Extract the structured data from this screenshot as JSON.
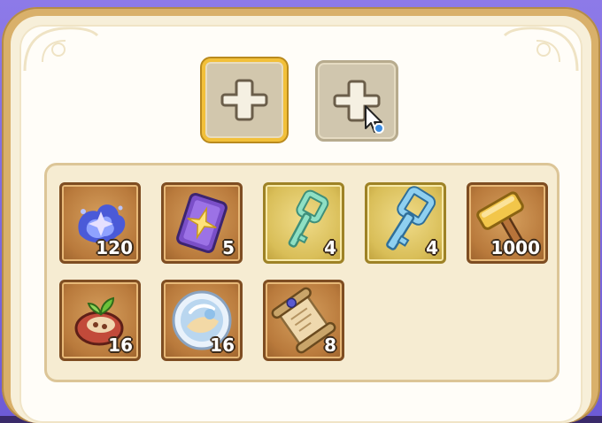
{
  "equip_slots": [
    {
      "name": "slot-1",
      "icon": "plus-icon",
      "selected": true
    },
    {
      "name": "slot-2",
      "icon": "plus-icon",
      "selected": false
    }
  ],
  "inventory": {
    "items": [
      {
        "icon": "arcane-crystal-icon",
        "quantity": "120",
        "rarity": "brown"
      },
      {
        "icon": "spell-card-icon",
        "quantity": "5",
        "rarity": "brown"
      },
      {
        "icon": "green-key-icon",
        "quantity": "4",
        "rarity": "gold"
      },
      {
        "icon": "blue-key-icon",
        "quantity": "4",
        "rarity": "gold"
      },
      {
        "icon": "golden-hammer-icon",
        "quantity": "1000",
        "rarity": "brown"
      },
      {
        "icon": "seed-pod-icon",
        "quantity": "16",
        "rarity": "brown"
      },
      {
        "icon": "pearl-orb-icon",
        "quantity": "16",
        "rarity": "brown"
      },
      {
        "icon": "scroll-icon",
        "quantity": "8",
        "rarity": "brown"
      }
    ]
  },
  "colors": {
    "frame_purple": "#7a66dd",
    "frame_gold": "#d9b06a",
    "selection_gold": "#f2c03a",
    "panel_bg": "#f6ecd2"
  }
}
